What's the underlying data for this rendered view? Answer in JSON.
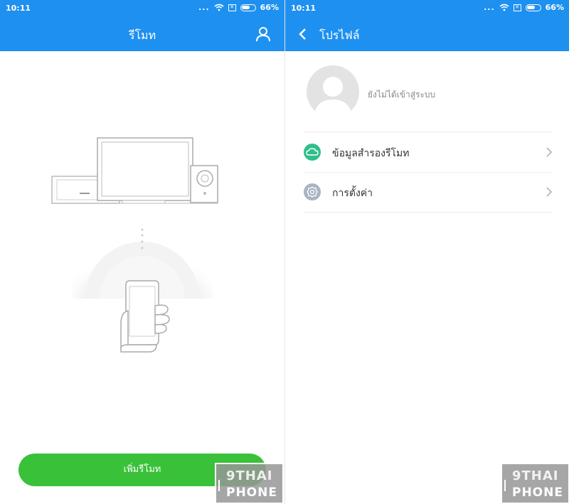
{
  "left_screen": {
    "status_bar": {
      "time": "10:11",
      "more": "...",
      "battery": "66%",
      "battery_level": 0.66
    },
    "header": {
      "title": "รีโมท",
      "profile_icon": "user-icon"
    },
    "add_button": {
      "label": "เพิ่มรีโมท"
    },
    "watermark": {
      "line1": "9THAI",
      "line2": "PHONE"
    }
  },
  "right_screen": {
    "status_bar": {
      "time": "10:11",
      "more": "...",
      "battery": "66%",
      "battery_level": 0.66
    },
    "header": {
      "title": "โปรไฟล์",
      "back_icon": "back-arrow-icon"
    },
    "profile": {
      "status": "ยังไม่ได้เข้าสู่ระบบ",
      "avatar_icon": "default-avatar-icon"
    },
    "menu": [
      {
        "label": "ข้อมูลสำรองรีโมท",
        "icon": "cloud-icon",
        "icon_color": "#2fbf8a"
      },
      {
        "label": "การตั้งค่า",
        "icon": "gear-icon",
        "icon_color": "#a8b4c2"
      }
    ],
    "watermark": {
      "line1": "9THAI",
      "line2": "PHONE"
    }
  },
  "colors": {
    "header": "#1e90f0",
    "add_button": "#39c13a"
  }
}
